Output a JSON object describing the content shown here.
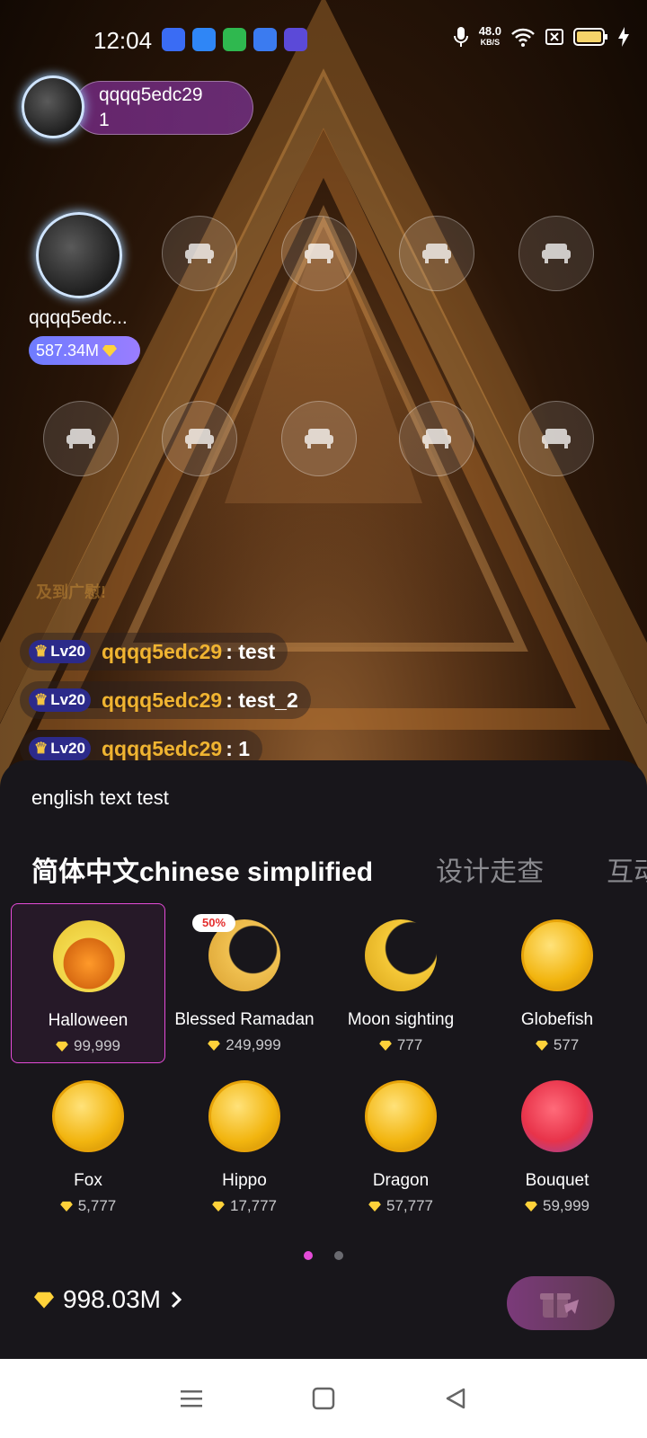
{
  "status_bar": {
    "time": "12:04",
    "net_speed_value": "48.0",
    "net_speed_unit": "KB/S"
  },
  "host": {
    "name": "qqqq5edc29",
    "count": "1"
  },
  "mic": {
    "name": "qqqq5edc...",
    "score": "587.34M"
  },
  "notice_text": "及到广慰!",
  "chat": [
    {
      "level": "Lv20",
      "user": "qqqq5edc29",
      "message": ": test"
    },
    {
      "level": "Lv20",
      "user": "qqqq5edc29",
      "message": ": test_2"
    },
    {
      "level": "Lv20",
      "user": "qqqq5edc29",
      "message": ": 1"
    }
  ],
  "panel": {
    "text": "english text test",
    "tabs": [
      "简体中文chinese simplified",
      "设计走查",
      "互动"
    ],
    "gifts": [
      {
        "name": "Halloween",
        "price": "99,999",
        "icon": "pumpkin-icon",
        "color": "#f2c94c"
      },
      {
        "name": "Blessed Ramadan",
        "price": "249,999",
        "icon": "crescent-mosque-icon",
        "color": "#e8b850",
        "badge": "50%"
      },
      {
        "name": "Moon sighting",
        "price": "777",
        "icon": "moon-star-icon",
        "color": "#f0c030"
      },
      {
        "name": "Globefish",
        "price": "577",
        "icon": "globefish-coin-icon",
        "color": "#f2b50f"
      },
      {
        "name": "Fox",
        "price": "5,777",
        "icon": "fox-coin-icon",
        "color": "#f2b50f"
      },
      {
        "name": "Hippo",
        "price": "17,777",
        "icon": "hippo-coin-icon",
        "color": "#f2b50f"
      },
      {
        "name": "Dragon",
        "price": "57,777",
        "icon": "dragon-coin-icon",
        "color": "#f2b50f"
      },
      {
        "name": "Bouquet",
        "price": "59,999",
        "icon": "rose-bouquet-icon",
        "color": "#e8334a"
      }
    ],
    "page_indicator": {
      "pages": 2,
      "current": 1
    },
    "balance": "998.03M"
  },
  "colors": {
    "accent": "#e44bd8",
    "gold": "#f0b431",
    "level_badge": "#2c2a8a"
  }
}
